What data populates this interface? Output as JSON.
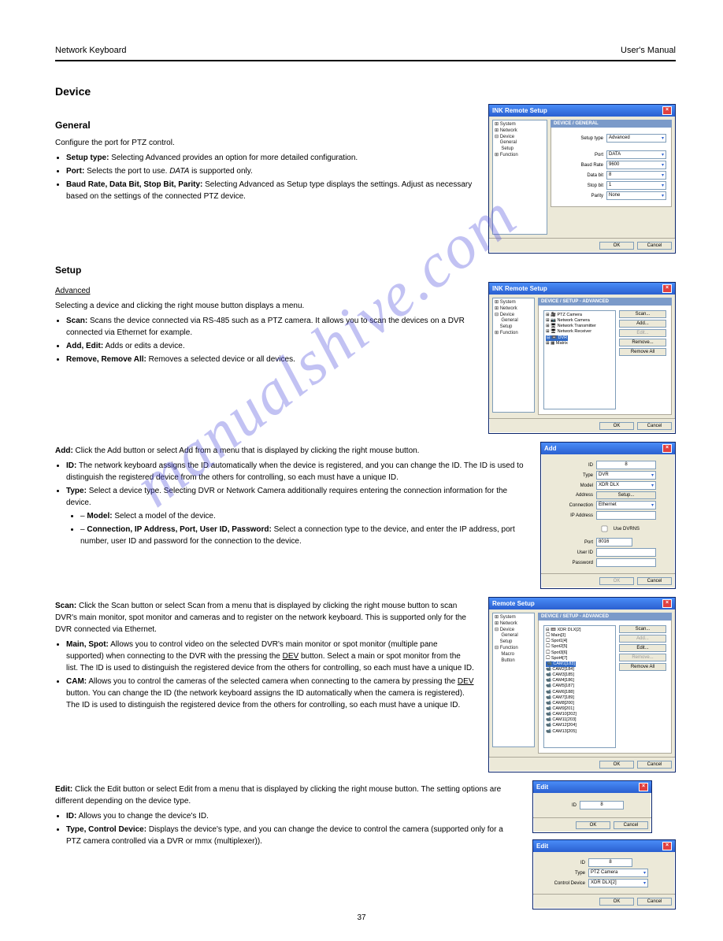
{
  "header": {
    "left": "Network Keyboard",
    "right": "User's Manual"
  },
  "watermark": "manualshive.com",
  "pageno": "37",
  "sections": {
    "device_title": "Device",
    "general_title": "General",
    "general_intro": "Configure the port for PTZ control.",
    "general_items_html": "<li><b>Setup type:</b> Selecting Advanced provides an option for more detailed configuration.</li><li><b>Port:</b> Selects the port to use. <i>DATA</i> is supported only.</li><li><b>Baud Rate, Data Bit, Stop Bit, Parity:</b> Selecting Advanced as Setup type displays the settings. Adjust as necessary based on the settings of the connected PTZ device.</li>",
    "setup_title": "Setup",
    "adv_title": "Advanced",
    "adv_intro": "Selecting a device and clicking the right mouse button displays a menu.",
    "adv_items_html": "<li><b>Scan:</b> Scans the device connected via RS-485 such as a PTZ camera. It allows you to scan the devices on a DVR connected via Ethernet for example.</li><li><b>Add, Edit:</b> Adds or edits a device.</li><li><b>Remove, Remove All:</b> Removes a selected device or all devices.</li>",
    "add_text": "<b>Add:</b> Click the Add button or select Add from a menu that is displayed by clicking the right mouse button.",
    "add_items_html": "<li><b>ID:</b> The network keyboard assigns the ID automatically when the device is registered, and you can change the ID. The ID is used to distinguish the registered device from the others for controlling, so each must have a unique ID.</li><li><b>Type:</b> Select a device type. Selecting DVR or Network Camera additionally requires entering the connection information for the device.</li><li class='sub'>– <b>Model:</b> Select a model of the device.</li><li class='sub'>– <b>Connection, IP Address, Port, User ID, Password:</b> Select a connection type to the device, and enter the IP address, port number, user ID and password for the connection to the device.</li>",
    "scan_text": "<b>Scan:</b> Click the Scan button or select Scan from a menu that is displayed by clicking the right mouse button to scan DVR's main monitor, spot monitor and cameras and to register on the network keyboard. This is supported only for the DVR connected via Ethernet.",
    "scan_items_html": "<li><b>Main, Spot:</b> Allows you to control video on the selected DVR's main monitor or spot monitor (multiple pane supported) when connecting to the DVR with the pressing the <u>DEV</u> button. Select a main or spot monitor from the list. The ID is used to distinguish the registered device from the others for controlling, so each must have a unique ID.</li><li><b>CAM:</b> Allows you to control the cameras of the selected camera when connecting to the camera by pressing the <u>DEV</u> button. You can change the ID (the network keyboard assigns the ID automatically when the camera is registered). The ID is used to distinguish the registered device from the others for controlling, so each must have a unique ID.</li>",
    "edit_text": "<b>Edit:</b> Click the Edit button or select Edit from a menu that is displayed by clicking the right mouse button. The setting options are different depending on the device type.",
    "edit_items_html": "<li><b>ID:</b> Allows you to change the device's ID.</li><li><b>Type, Control Device:</b> Displays the device's type, and you can change the device to control the camera (supported only for a PTZ camera controlled via a DVR or mmx (multiplexer)).</li>"
  },
  "win1": {
    "title": "INK Remote Setup",
    "tree": [
      "⊞ System",
      "⊞ Network",
      "⊟ Device",
      "    General",
      "    Setup",
      "⊞ Function"
    ],
    "tree_sel_idx": 3,
    "panel": "DEVICE / GENERAL",
    "fields": {
      "type": "Advanced",
      "port": "DATA",
      "baud": "9600",
      "databit": "8",
      "stopbit": "1",
      "parity": "None"
    },
    "labels": {
      "type": "Setup type",
      "port": "Port",
      "baud": "Baud Rate",
      "databit": "Data bit",
      "stopbit": "Stop bit",
      "parity": "Parity"
    },
    "ok": "OK",
    "cancel": "Cancel"
  },
  "win2": {
    "title": "INK Remote Setup",
    "tree": [
      "⊞ System",
      "⊞ Network",
      "⊟ Device",
      "    General",
      "    Setup",
      "⊞ Function"
    ],
    "tree_sel_idx": 4,
    "panel": "DEVICE / SETUP - ADVANCED",
    "devtree": [
      "⊞ 🎥 PTZ Camera",
      "⊞ 📷 Network Camera",
      "⊞ 🖥 Network Transmitter",
      "⊞ 🖥 Network Receiver",
      "⊟ 📼 DVR",
      "⊞ ▦ Matrix"
    ],
    "dev_sel_idx": 4,
    "buttons": [
      "Scan...",
      "Add...",
      "Edit...",
      "Remove...",
      "Remove All"
    ],
    "btn_dis_idx": 2,
    "ok": "OK",
    "cancel": "Cancel"
  },
  "win3": {
    "title": "Add",
    "labels": {
      "id": "ID",
      "type": "Type",
      "model": "Model",
      "addr": "Address",
      "conn": "Connection",
      "ip": "IP Address",
      "port": "Port",
      "user": "User ID",
      "pass": "Password",
      "usedvrns": "Use DVRNS"
    },
    "vals": {
      "id": "8",
      "type": "DVR",
      "model": "XDR DLX",
      "addr": "Setup...",
      "conn": "Ethernet",
      "ip": "",
      "port": "8016",
      "user": "",
      "pass": ""
    },
    "ok": "OK",
    "cancel": "Cancel"
  },
  "win4": {
    "title": "Remote Setup",
    "tree": [
      "⊞ System",
      "⊞ Network",
      "⊟ Device",
      "    General",
      "    Setup",
      "⊟ Function",
      "    Macro",
      "    Button"
    ],
    "tree_sel_idx": 4,
    "panel": "DEVICE / SETUP - ADVANCED",
    "devtree": [
      "⊟ 📼 XDR DLX[2]",
      "  🖵 Main[3]",
      "  🖵 Spot1[4]",
      "  🖵 Spot2[5]",
      "  🖵 Spot3[6]",
      "  🖵 Spot4[7]",
      "  📹 CAM1[183]",
      "  📹 CAM2[184]",
      "  📹 CAM3[185]",
      "  📹 CAM4[186]",
      "  📹 CAM5[187]",
      "  📹 CAM6[188]",
      "  📹 CAM7[189]",
      "  📹 CAM8[200]",
      "  📹 CAM9[201]",
      "  📹 CAM10[202]",
      "  📹 CAM11[203]",
      "  📹 CAM12[204]",
      "  📹 CAM13[205]"
    ],
    "dev_sel_idx": 6,
    "buttons": [
      "Scan...",
      "Add...",
      "Edit...",
      "Remove...",
      "Remove All"
    ],
    "btn_dis_idx": [
      1,
      3
    ],
    "ok": "OK",
    "cancel": "Cancel"
  },
  "win5": {
    "title": "Edit",
    "labels": {
      "id": "ID"
    },
    "vals": {
      "id": "8"
    },
    "ok": "OK",
    "cancel": "Cancel"
  },
  "win6": {
    "title": "Edit",
    "labels": {
      "id": "ID",
      "type": "Type",
      "ctrl": "Control Device"
    },
    "vals": {
      "id": "8",
      "type": "PTZ Camera",
      "ctrl": "XDR DLX[2]"
    },
    "ok": "OK",
    "cancel": "Cancel"
  }
}
